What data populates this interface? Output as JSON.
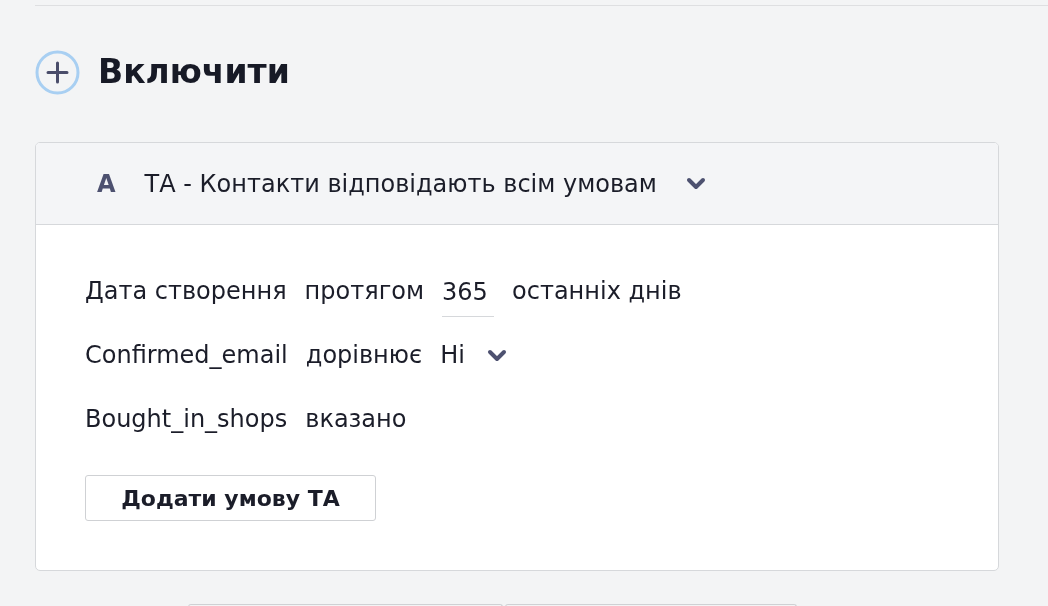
{
  "section": {
    "title": "Включити"
  },
  "group": {
    "letter": "A",
    "title": "ТА - Контакти відповідають всім умовам"
  },
  "conditions": [
    {
      "kind": "input",
      "field": "Дата створення",
      "operator": "протягом",
      "value": "365",
      "suffix": "останніх днів"
    },
    {
      "kind": "select",
      "field": "Confirmed_email",
      "operator": "дорівнює",
      "value": "Ні"
    },
    {
      "kind": "plain",
      "field": "Bought_in_shops",
      "operator": "вказано"
    }
  ],
  "add_button": "Додати умову ТА"
}
